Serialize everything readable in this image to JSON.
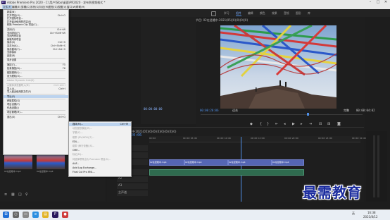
{
  "window": {
    "title": "Adobe Premiere Pro 2020 - C:\\用户\\Sibo\\桌面\\PR2020 · 发布到视频格式 *",
    "icon_label": "Pr"
  },
  "menubar": {
    "items": [
      "文件(F)",
      "编辑(E)",
      "剪辑(C)",
      "序列(S)",
      "标记(M)",
      "图形(G)",
      "视图(V)",
      "窗口(W)",
      "帮助(H)"
    ],
    "active_index": 0
  },
  "workspace_tabs": {
    "items": [
      "学习",
      "组件",
      "编辑",
      "颜色",
      "效果",
      "音频",
      "图形",
      "库"
    ],
    "active_index": 1
  },
  "file_menu": {
    "items": [
      {
        "label": "新建(N)",
        "shortcut": "",
        "disabled": false
      },
      {
        "label": "打开项目(O)...",
        "shortcut": "Ctrl+O",
        "disabled": false
      },
      {
        "label": "打开团队项目...",
        "shortcut": "",
        "disabled": false
      },
      {
        "label": "打开最近使用的内容(E)",
        "shortcut": "",
        "disabled": false
      },
      {
        "label": "转换 Premiere Clip 项目(C)...",
        "shortcut": "",
        "disabled": false
      },
      {
        "sep": true
      },
      {
        "label": "关闭(C)",
        "shortcut": "Ctrl+W",
        "disabled": false
      },
      {
        "label": "关闭项目(P)",
        "shortcut": "Ctrl+Shift+W",
        "disabled": false
      },
      {
        "label": "关闭所有项目",
        "shortcut": "",
        "disabled": false
      },
      {
        "label": "刷新所有项目",
        "shortcut": "",
        "disabled": false
      },
      {
        "label": "保存(S)",
        "shortcut": "Ctrl+S",
        "disabled": false
      },
      {
        "label": "另存为(A)...",
        "shortcut": "Ctrl+Shift+S",
        "disabled": false
      },
      {
        "label": "保存副本(Y)...",
        "shortcut": "Ctrl+Alt+S",
        "disabled": false
      },
      {
        "label": "全部保存",
        "shortcut": "",
        "disabled": false
      },
      {
        "label": "还原(R)",
        "shortcut": "",
        "disabled": false
      },
      {
        "sep": true
      },
      {
        "label": "同步设置",
        "shortcut": "",
        "disabled": false
      },
      {
        "sep": true
      },
      {
        "label": "捕捉(T)...",
        "shortcut": "F5",
        "disabled": false
      },
      {
        "label": "批量捕捉(B)...",
        "shortcut": "F6",
        "disabled": false
      },
      {
        "sep": true
      },
      {
        "label": "链接媒体(L)...",
        "shortcut": "",
        "disabled": false
      },
      {
        "label": "设为脱机(O)...",
        "shortcut": "",
        "disabled": false
      },
      {
        "sep": true
      },
      {
        "label": "Adobe Dynamic Link(K)",
        "shortcut": "",
        "disabled": true
      },
      {
        "sep": true
      },
      {
        "label": "从媒体浏览器导入(M)",
        "shortcut": "Ctrl+Alt+I",
        "disabled": true
      },
      {
        "label": "导入(I)...",
        "shortcut": "Ctrl+I",
        "disabled": false
      },
      {
        "label": "导入最近使用的文件(F)",
        "shortcut": "",
        "disabled": false
      },
      {
        "sep": true
      },
      {
        "label": "导出(E)",
        "shortcut": "",
        "disabled": false,
        "highlight": true
      },
      {
        "sep": true
      },
      {
        "label": "获取属性(G)",
        "shortcut": "",
        "disabled": false
      },
      {
        "label": "项目设置(P)",
        "shortcut": "",
        "disabled": false
      },
      {
        "label": "作品设置(J)",
        "shortcut": "",
        "disabled": false
      },
      {
        "sep": true
      },
      {
        "label": "项目管理(M)...",
        "shortcut": "",
        "disabled": false
      },
      {
        "sep": true
      },
      {
        "label": "退出(X)",
        "shortcut": "Ctrl+Q",
        "disabled": false
      }
    ]
  },
  "export_menu": {
    "items": [
      {
        "label": "媒体(M)...",
        "shortcut": "Ctrl+M",
        "disabled": false,
        "highlight": true
      },
      {
        "label": "动态图形模板(R)...",
        "shortcut": "",
        "disabled": true
      },
      {
        "label": "字幕(C)...",
        "shortcut": "",
        "disabled": true
      },
      {
        "label": "磁带 (DV/HDV)(T)...",
        "shortcut": "",
        "disabled": true
      },
      {
        "label": "EDL...",
        "shortcut": "",
        "disabled": false
      },
      {
        "label": "磁带 (串行设备)(S)...",
        "shortcut": "",
        "disabled": true
      },
      {
        "label": "OMF...",
        "shortcut": "",
        "disabled": false
      },
      {
        "label": "标记(M)...",
        "shortcut": "",
        "disabled": true
      },
      {
        "label": "将选择项导出为 Premiere 项目(S)...",
        "shortcut": "",
        "disabled": true
      },
      {
        "label": "AAF...",
        "shortcut": "",
        "disabled": false
      },
      {
        "label": "Avid Log Exchange...",
        "shortcut": "",
        "disabled": false
      },
      {
        "label": "Final Cut Pro XML...",
        "shortcut": "",
        "disabled": false
      }
    ]
  },
  "program_monitor": {
    "title": "节目: 02在经幡中·2021(05)(0)(0)(0)(0)",
    "timecode_current": "00:00:20:06",
    "timecode_duration": "00:00:04:02",
    "fit_label": "适合",
    "quality_label": "完整",
    "left_timecode": "00:00:00:00"
  },
  "timeline": {
    "sequence_name": "02在经幡中·2021(05)(0)(0)(0)(0)(0)(0)(0)",
    "timecode": "00:00:20:06",
    "ruler_labels": [
      "00:00",
      "00:00:05:00",
      "00:00:10:00",
      "00:00:15:00",
      "00:00:20:00",
      "00:00:25:00",
      "00:00:30:00"
    ],
    "tracks": [
      "V3",
      "V2",
      "V1",
      "A1",
      "A2",
      "A3",
      "主声道"
    ],
    "video_clips": [
      "02在经幡中.mp4",
      "02在经幡中.mp4",
      "02在经幡中.mp4",
      "02在经幡中.mp4"
    ],
    "master_value": "0.0"
  },
  "project_panel": {
    "items": [
      "02在经幡中.mp4",
      "02在经幡中.mp4",
      "02在经幡中.mp4"
    ]
  },
  "taskbar": {
    "time": "16:38",
    "date": "2021/8/12",
    "lang": "英"
  },
  "watermark": {
    "text": "最需教育"
  }
}
